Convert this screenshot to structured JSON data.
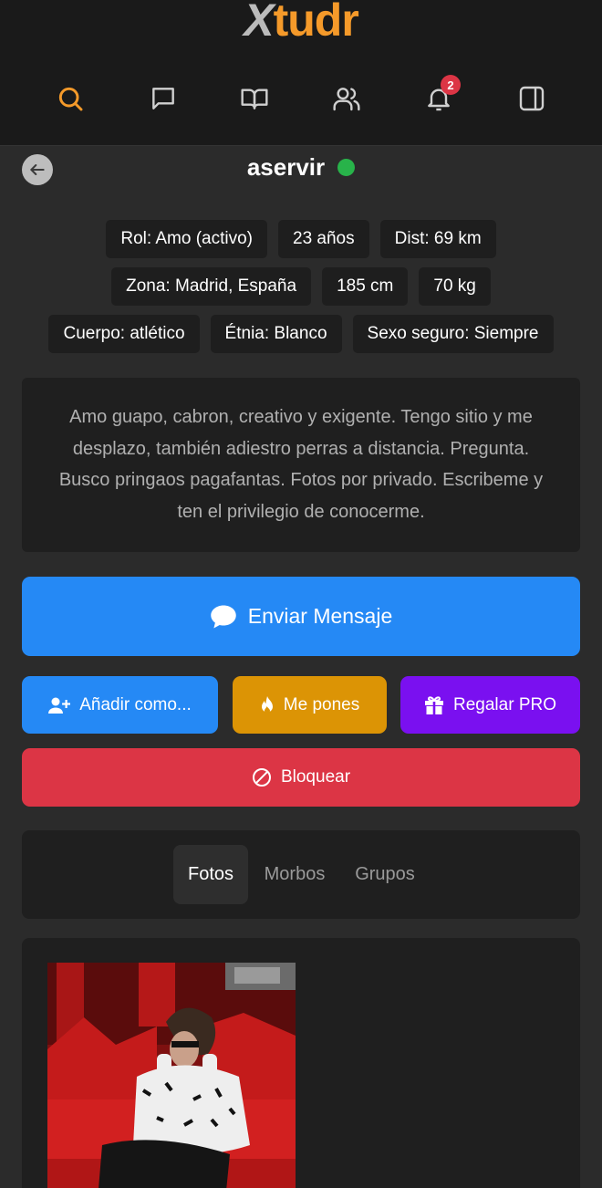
{
  "app": {
    "logo_x": "X",
    "logo_rest": "tudr"
  },
  "nav": {
    "items": [
      {
        "name": "search",
        "icon": "search-icon",
        "active": true
      },
      {
        "name": "messages",
        "icon": "chat-icon"
      },
      {
        "name": "stories",
        "icon": "book-open-icon"
      },
      {
        "name": "users",
        "icon": "users-icon"
      },
      {
        "name": "notifications",
        "icon": "bell-icon",
        "badge": "2"
      },
      {
        "name": "sidebar",
        "icon": "sidebar-icon"
      }
    ]
  },
  "profile": {
    "username": "aservir",
    "online": true,
    "tags_row1": [
      "Rol: Amo (activo)",
      "23 años",
      "Dist: 69 km"
    ],
    "tags_row2": [
      "Zona: Madrid, España",
      "185 cm",
      "70 kg"
    ],
    "tags_row3": [
      "Cuerpo: atlético",
      "Étnia: Blanco",
      "Sexo seguro: Siempre"
    ],
    "bio": "Amo guapo, cabron, creativo y exigente. Tengo sitio y me desplazo, también adiestro perras a distancia. Pregunta. Busco pringaos pagafantas. Fotos por privado. Escribeme y ten el privilegio de conocerme."
  },
  "actions": {
    "send_message": "Enviar Mensaje",
    "add_as": "Añadir como...",
    "me_pones": "Me pones",
    "gift_pro": "Regalar PRO",
    "block": "Bloquear"
  },
  "tabs": {
    "photos": "Fotos",
    "morbos": "Morbos",
    "groups": "Grupos",
    "active": "photos"
  },
  "colors": {
    "accent_orange": "#f59a2a",
    "primary_blue": "#2589f5",
    "warning": "#dc9405",
    "purple": "#7a10f0",
    "danger": "#dc3545",
    "online_green": "#28b34a"
  }
}
